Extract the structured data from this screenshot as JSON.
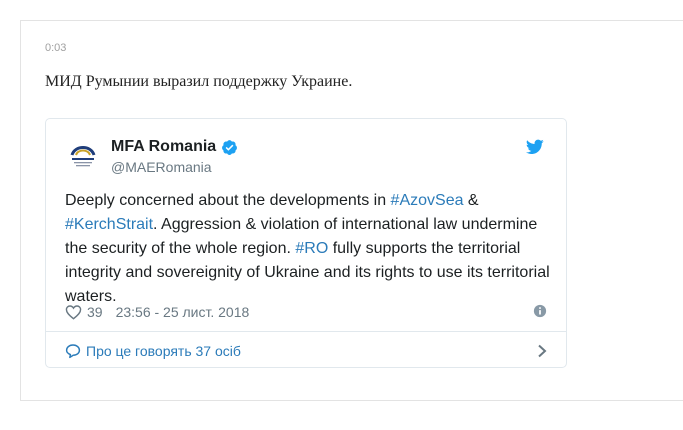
{
  "article": {
    "time": "0:03",
    "headline": "МИД Румынии выразил поддержку Украине."
  },
  "tweet": {
    "author_name": "MFA Romania",
    "handle": "@MAERomania",
    "text": {
      "p1": "Deeply concerned about the developments  in ",
      "tag1": "#AzovSea",
      "p2": " & ",
      "tag2": "#KerchStrait",
      "p3": ". Aggression & violation of international law undermine the security of the whole region. ",
      "tag3": "#RO",
      "p4": " fully supports the territorial integrity and sovereignity of Ukraine and its rights to use its territorial waters."
    },
    "likes": "39",
    "timestamp": "23:56 - 25 лист. 2018",
    "conversation_label": "Про це говорять 37 осіб",
    "icons": {
      "verified": "verified-badge-icon",
      "bird": "twitter-bird-icon",
      "heart": "heart-icon",
      "info": "info-icon",
      "bubble": "speech-bubble-icon",
      "chevron": "chevron-right-icon"
    },
    "colors": {
      "link": "#2b7bb9",
      "twitter_blue": "#1da1f2",
      "muted": "#697882"
    }
  }
}
